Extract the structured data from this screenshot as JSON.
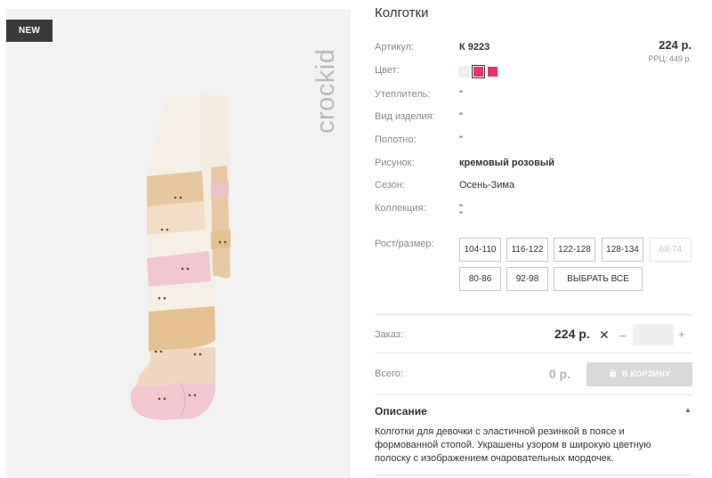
{
  "badge": "NEW",
  "brand": "crockid",
  "product": {
    "title": "Колготки",
    "price": "224 р.",
    "rrp": "РРЦ: 449 р."
  },
  "specs": {
    "article_label": "Артикул:",
    "article_value": "К 9223",
    "color_label": "Цвет:",
    "colors": [
      "#f7f1ea",
      "#e8336e",
      "#e8336e"
    ],
    "filler_label": "Утеплитель:",
    "filler_value": "\"",
    "type_label": "Вид изделия:",
    "type_value": "\"",
    "fabric_label": "Полотно:",
    "fabric_value": "\"",
    "pattern_label": "Рисунок:",
    "pattern_value": "кремовый розовый",
    "season_label": "Сезон:",
    "season_value": "Осень-Зима",
    "collection_label": "Коллекция:",
    "collection_value_1": "\"",
    "collection_value_2": "\"",
    "size_label": "Рост/размер:"
  },
  "sizes": [
    "104-110",
    "116-122",
    "122-128",
    "128-134",
    "68-74",
    "80-86",
    "92-98"
  ],
  "select_all": "ВЫБРАТЬ ВСЕ",
  "order": {
    "label": "Заказ:",
    "price": "224 р.",
    "times_icon": "✕",
    "minus": "–",
    "qty": "",
    "plus": "+"
  },
  "total": {
    "label": "Всего:",
    "value": "0 р.",
    "cart_button": "В КОРЗИНУ"
  },
  "description": {
    "title": "Описание",
    "text": "Колготки для девочки с эластичной резинкой в поясе и формованной стопой. Украшены узором в широкую цветную полоску с изображением очаровательных мордочек."
  }
}
